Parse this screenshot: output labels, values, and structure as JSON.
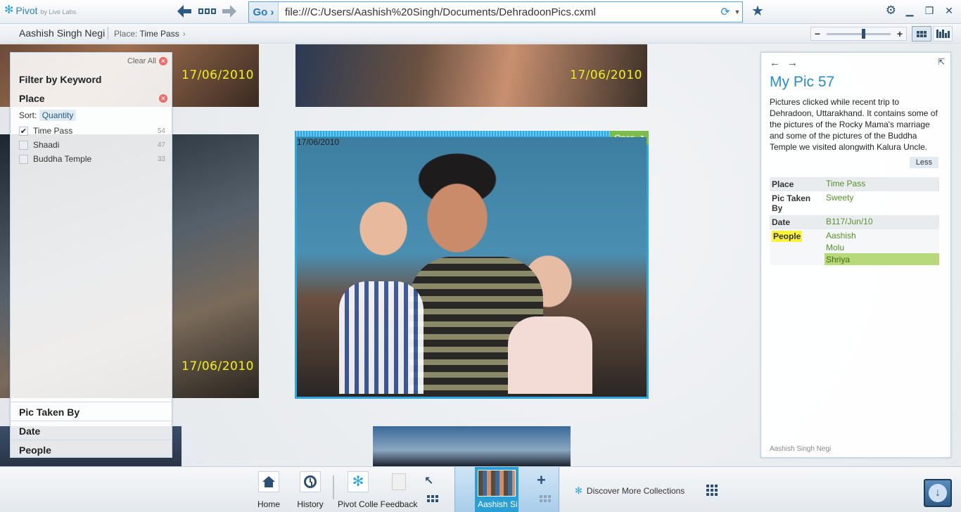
{
  "app": {
    "name": "Pivot",
    "by": "by Live Labs"
  },
  "address": {
    "go_label": "Go ›",
    "url": "file:///C:/Users/Aashish%20Singh/Documents/DehradoonPics.cxml"
  },
  "breadcrumb": {
    "collection": "Aashish Singh Negi",
    "place_label": "Place:",
    "place_value": "Time Pass"
  },
  "zoom": {
    "level": 0.55
  },
  "photos": {
    "date_stamp": "17/06/2010"
  },
  "selected_item": {
    "open_label": "Open ↗"
  },
  "filter_panel": {
    "clear_all": "Clear All",
    "keyword_label": "Filter by Keyword",
    "place_heading": "Place",
    "sort_label": "Sort:",
    "sort_value": "Quantity",
    "items": [
      {
        "label": "Time Pass",
        "count": "54",
        "checked": true
      },
      {
        "label": "Shaadi",
        "count": "47",
        "checked": false
      },
      {
        "label": "Buddha Temple",
        "count": "33",
        "checked": false
      }
    ],
    "sections": [
      "Pic Taken By",
      "Date",
      "People"
    ]
  },
  "info_panel": {
    "title": "My Pic 57",
    "description": "Pictures clicked while recent trip to Dehradoon, Uttarakhand. It contains some of the pictures of the Rocky Mama's marriage and some of the pictures of the Buddha Temple we visited alongwith Kalura Uncle.",
    "less_label": "Less",
    "facets": [
      {
        "key": "Place",
        "values": [
          "Time Pass"
        ]
      },
      {
        "key": "Pic Taken By",
        "values": [
          "Sweety"
        ]
      },
      {
        "key": "Date",
        "values": [
          "B117/Jun/10"
        ]
      },
      {
        "key": "People",
        "values": [
          "Aashish",
          "Molu",
          "Shriya"
        ]
      }
    ],
    "footer": "Aashish Singh Negi"
  },
  "dock": {
    "home": "Home",
    "history": "History",
    "pivot_collections": "Pivot Collec",
    "feedback": "Feedback",
    "active_collection": "Aashish Si",
    "discover": "Discover More Collections"
  },
  "colors": {
    "accent": "#2aa6e0",
    "open_green": "#7bbd4a",
    "date_yellow": "#f0ea3a",
    "highlight_yellow": "#fbf33a",
    "selected_value_green": "#b8d97a"
  },
  "icons": [
    "pivot-logo-icon",
    "back-arrow-icon",
    "tiles-icon",
    "forward-arrow-icon",
    "refresh-icon",
    "dropdown-icon",
    "star-icon",
    "gear-icon",
    "minimize-icon",
    "restore-icon",
    "close-icon",
    "zoom-minus-icon",
    "zoom-plus-icon",
    "grid-view-icon",
    "bar-view-icon",
    "home-icon",
    "history-icon",
    "pivot-collections-icon",
    "feedback-icon",
    "corner-arrow-icon",
    "plus-icon",
    "download-icon"
  ]
}
